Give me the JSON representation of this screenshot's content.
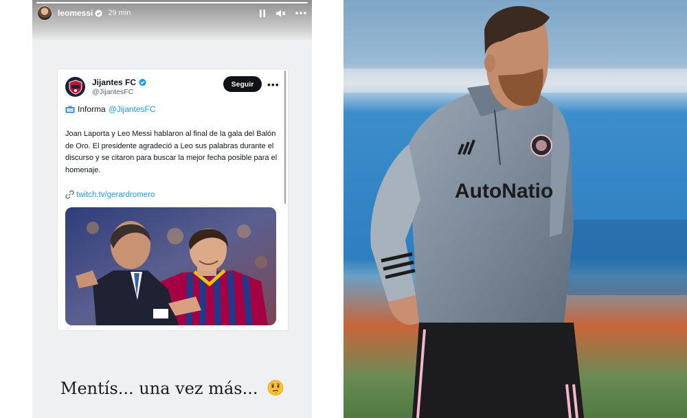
{
  "story": {
    "username": "leomessi",
    "time": "29 min",
    "progress": 1.0,
    "icons": {
      "verified": "verified-badge-icon",
      "pause": "pause-icon",
      "mute": "mute-icon",
      "more": "more-options-icon"
    },
    "caption": "Mentís... una vez más...",
    "caption_emoji": "🫤"
  },
  "tweet": {
    "account_name": "Jijantes FC",
    "handle": "@JijantesFC",
    "follow_label": "Seguir",
    "more_label": "•••",
    "informa_label": "Informa",
    "informa_mention": "@JijantesFC",
    "body": "Joan Laporta y Leo Messi hablaron al final de la gala del Balón de Oro. El presidente agradeció a Leo sus palabras  durante el discurso y se citaron para buscar la mejor fecha posible para el homenaje.",
    "link": "twitch.tv/gerardromero",
    "colors": {
      "link": "#1d9bf0",
      "verified": "#1d9bf0",
      "follow_bg": "#0f1419"
    }
  },
  "photo": {
    "jersey_text": "AutoNatio",
    "colors": {
      "jersey": "#7c8a9a",
      "shorts": "#1c1c1e",
      "pink_accent": "#f4b6c8"
    }
  }
}
